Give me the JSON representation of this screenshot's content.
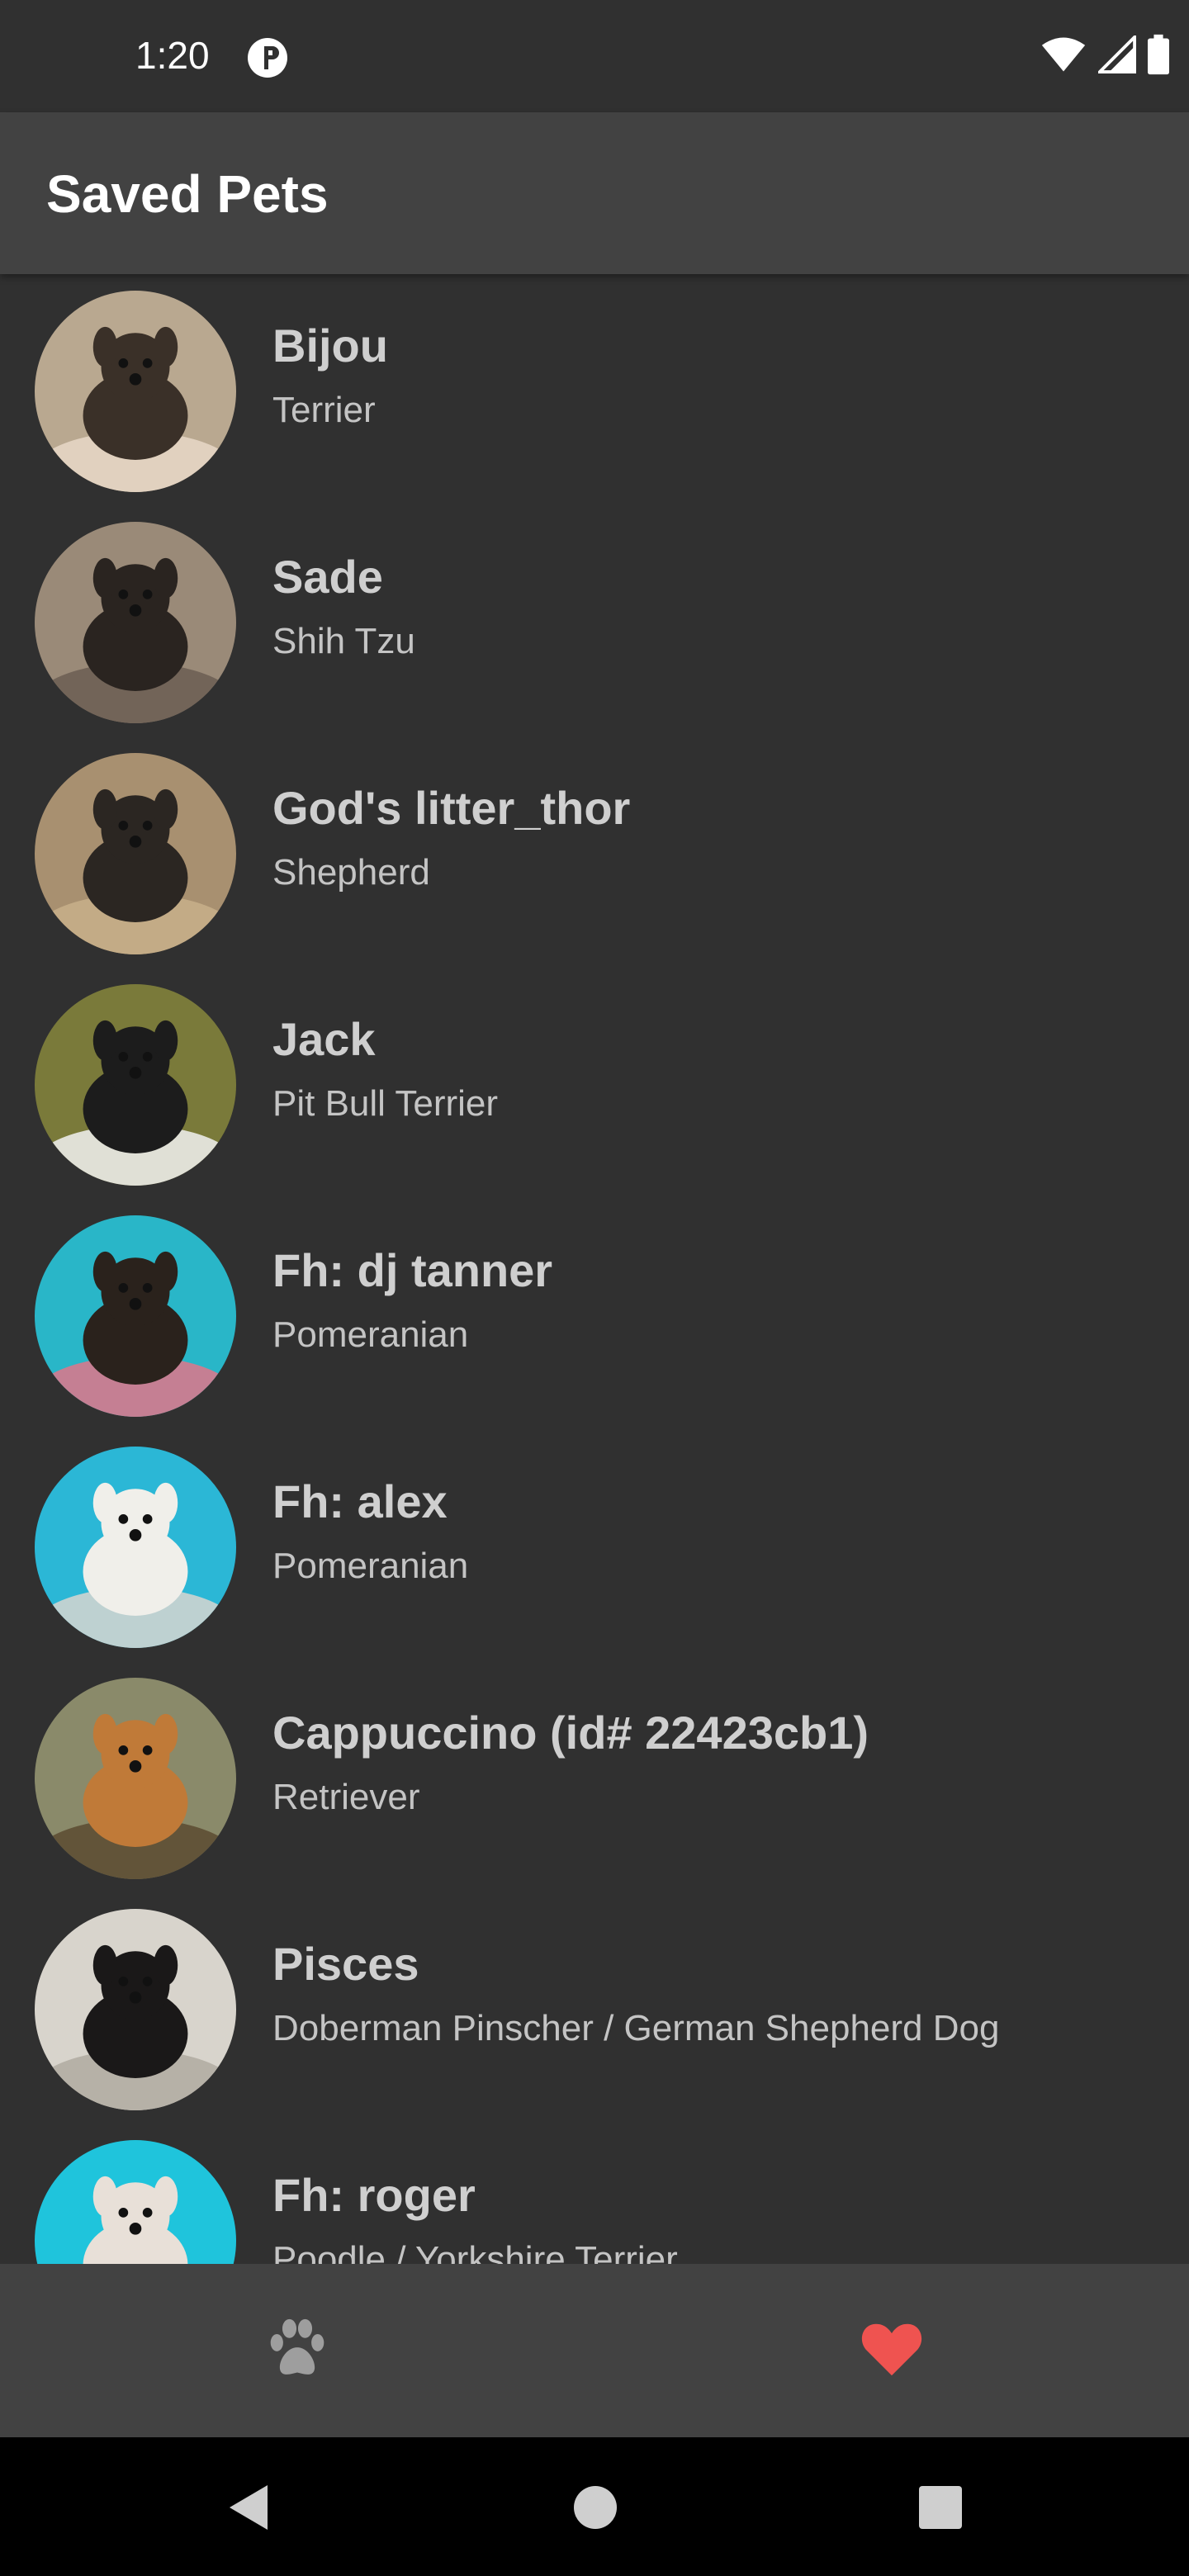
{
  "status_bar": {
    "time": "1:20",
    "icons": [
      "app-notification-icon",
      "wifi-icon",
      "cell-signal-icon",
      "battery-icon"
    ]
  },
  "app_bar": {
    "title": "Saved Pets",
    "background": "#424242"
  },
  "pets": [
    {
      "name": "Bijou",
      "breed": "Terrier",
      "photo_colors": [
        "#b9a890",
        "#3a3028",
        "#e8d8c8"
      ]
    },
    {
      "name": "Sade",
      "breed": "Shih Tzu",
      "photo_colors": [
        "#9a8a78",
        "#2a2420",
        "#6b5d52"
      ]
    },
    {
      "name": "God's litter_thor",
      "breed": "Shepherd",
      "photo_colors": [
        "#a89070",
        "#2b2622",
        "#c8b08a"
      ]
    },
    {
      "name": "Jack",
      "breed": "Pit Bull Terrier",
      "photo_colors": [
        "#7a7a3a",
        "#1c1c1c",
        "#f2f2f2"
      ]
    },
    {
      "name": "Fh: dj tanner",
      "breed": "Pomeranian",
      "photo_colors": [
        "#29b6c8",
        "#2a221c",
        "#e0758a"
      ]
    },
    {
      "name": "Fh: alex",
      "breed": "Pomeranian",
      "photo_colors": [
        "#2bb7d6",
        "#f0efea",
        "#d8d6d0"
      ]
    },
    {
      "name": "Cappuccino (id# 22423cb1)",
      "breed": "Retriever",
      "photo_colors": [
        "#8a8a6a",
        "#c07a38",
        "#5b4a30"
      ]
    },
    {
      "name": "Pisces",
      "breed": "Doberman Pinscher / German Shepherd Dog",
      "photo_colors": [
        "#d8d4cc",
        "#1a1818",
        "#b0aaa0"
      ]
    },
    {
      "name": "Fh: roger",
      "breed": "Poodle / Yorkshire Terrier",
      "photo_colors": [
        "#1fc4dc",
        "#e8e0d8",
        "#c04040"
      ]
    }
  ],
  "bottom_nav": {
    "items": [
      {
        "icon": "paw-icon",
        "color": "#9e9e9e"
      },
      {
        "icon": "heart-icon",
        "color": "#ef5350"
      }
    ]
  },
  "system_nav": {
    "icons": [
      "back-icon",
      "home-icon",
      "recents-icon"
    ]
  }
}
